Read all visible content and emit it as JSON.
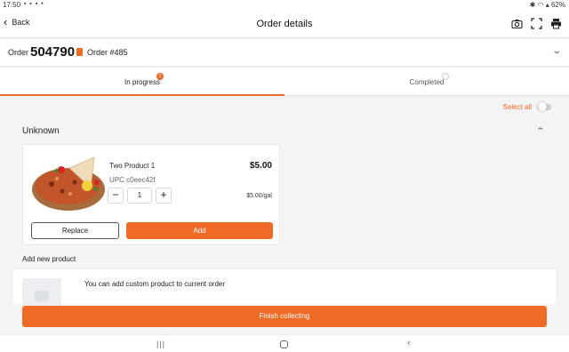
{
  "status_bar": {
    "time": "17:50",
    "battery": "62%"
  },
  "app_bar": {
    "back_label": "Back",
    "title": "Order details"
  },
  "order": {
    "label": "Order",
    "number": "504790",
    "reference": "Order #485"
  },
  "tabs": [
    {
      "label": "In progress",
      "badge": "1"
    },
    {
      "label": "Completed",
      "badge": "0"
    }
  ],
  "select_all_label": "Select all",
  "group_title": "Unknown",
  "product": {
    "name": "Two Product 1",
    "upc": "UPC c0eec42f",
    "price": "$5.00",
    "unit_price": "$5.00/gal",
    "quantity": "1",
    "minus": "−",
    "plus": "+",
    "replace_label": "Replace",
    "add_label": "Add"
  },
  "add_new": {
    "title": "Add new product",
    "text": "You can add custom product to current order"
  },
  "finish_label": "Finish collecting",
  "colors": {
    "accent": "#ee6a25"
  }
}
